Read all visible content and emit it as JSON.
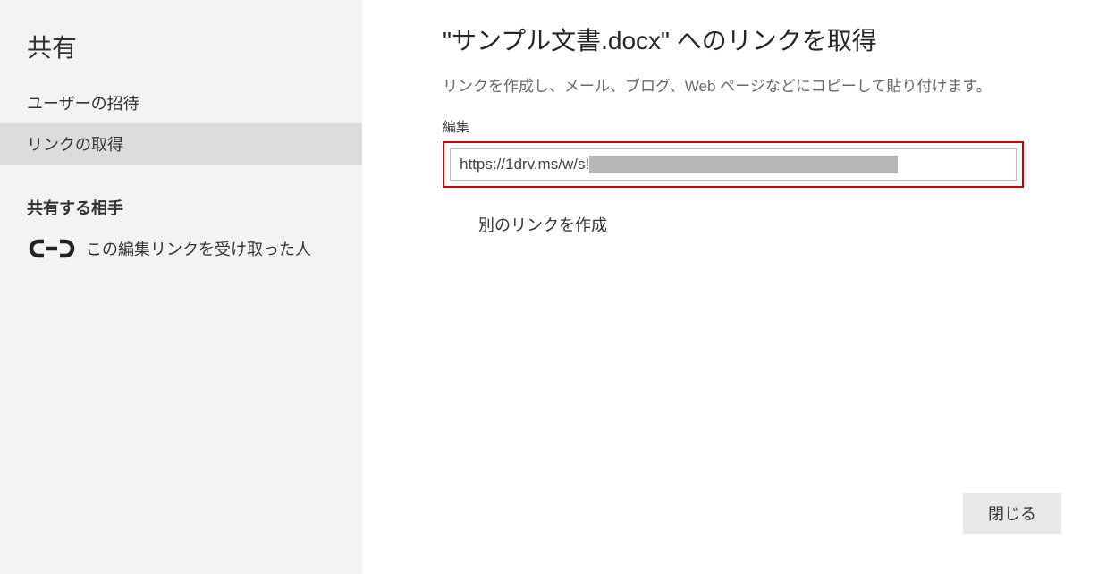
{
  "sidebar": {
    "title": "共有",
    "items": [
      {
        "label": "ユーザーの招待",
        "selected": false
      },
      {
        "label": "リンクの取得",
        "selected": true
      }
    ],
    "subheader": "共有する相手",
    "recipient_label": "この編集リンクを受け取った人"
  },
  "main": {
    "title": "\"サンプル文書.docx\" へのリンクを取得",
    "description": "リンクを作成し、メール、ブログ、Web ページなどにコピーして貼り付けます。",
    "field_label": "編集",
    "link_value": "https://1drv.ms/w/s!",
    "create_another_label": "別のリンクを作成",
    "close_label": "閉じる"
  }
}
